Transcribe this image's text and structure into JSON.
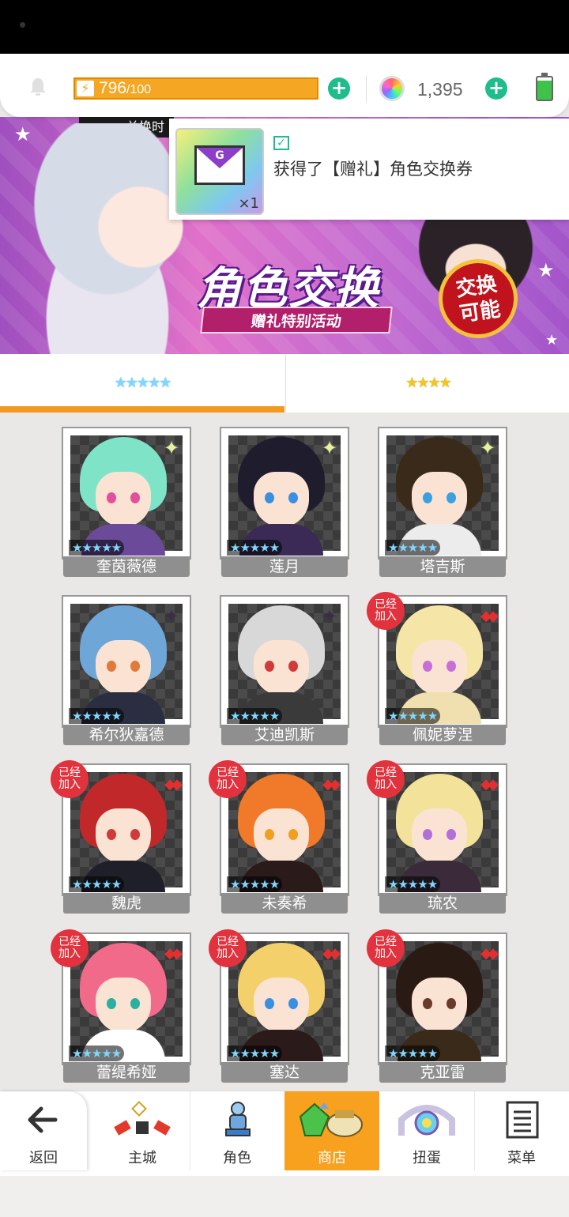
{
  "top_bar": {
    "energy_value": "796",
    "energy_max": "/100",
    "energy_fill": 1.0,
    "gem_count": "1,395"
  },
  "banner": {
    "title": "角色交换",
    "subtitle": "赠礼特别活动",
    "badge": "交换可能",
    "badge_line1": "交换",
    "badge_line2": "可能",
    "strip_label": "兑换时"
  },
  "toast": {
    "message": "获得了【赠礼】角色交换券",
    "qty": "×1",
    "item_letter": "G"
  },
  "tabs": [
    {
      "label": "★★★★★",
      "active": true
    },
    {
      "label": "★★★★",
      "active": false
    }
  ],
  "characters": [
    {
      "name": "奎茵薇德",
      "stars": "★★★★★",
      "added": false,
      "rank_icon": "sparkle-icon",
      "hair": "#7fe3c8",
      "eyes": "#e44f9c",
      "outfit": "#6b4a9a"
    },
    {
      "name": "莲月",
      "stars": "★★★★★",
      "added": false,
      "rank_icon": "sparkle-icon",
      "hair": "#1f1c2e",
      "eyes": "#3a8fe0",
      "outfit": "#3a2a55"
    },
    {
      "name": "塔吉斯",
      "stars": "★★★★★",
      "added": false,
      "rank_icon": "sparkle-icon",
      "hair": "#3a2a1a",
      "eyes": "#3aa0e0",
      "outfit": "#ececec"
    },
    {
      "name": "希尔狄嘉德",
      "stars": "★★★★★",
      "added": false,
      "rank_icon": "dark-sparkle-icon",
      "hair": "#6fa6d8",
      "eyes": "#e07a3a",
      "outfit": "#2a2e40"
    },
    {
      "name": "艾迪凯斯",
      "stars": "★★★★★",
      "added": false,
      "rank_icon": "dark-sparkle-icon",
      "hair": "#d8d8d8",
      "eyes": "#d03a3a",
      "outfit": "#3a3a3a"
    },
    {
      "name": "佩妮萝涅",
      "stars": "★★★★★",
      "added": true,
      "rank_icon": "diamond-icon",
      "hair": "#f5e6a8",
      "eyes": "#c86fd6",
      "outfit": "#f0e0b0"
    },
    {
      "name": "魏虎",
      "stars": "★★★★★",
      "added": true,
      "rank_icon": "diamond-icon",
      "hair": "#c0282a",
      "eyes": "#d03a3a",
      "outfit": "#1f1f2a"
    },
    {
      "name": "未奏希",
      "stars": "★★★★★",
      "added": true,
      "rank_icon": "diamond-icon",
      "hair": "#f07a2a",
      "eyes": "#f0a020",
      "outfit": "#2a1a1a"
    },
    {
      "name": "琉农",
      "stars": "★★★★★",
      "added": true,
      "rank_icon": "diamond-icon",
      "hair": "#f2e29a",
      "eyes": "#b070d8",
      "outfit": "#3a2a3a"
    },
    {
      "name": "蕾缇希娅",
      "stars": "★★★★★",
      "added": true,
      "rank_icon": "diamond-icon",
      "hair": "#f26a8a",
      "eyes": "#2ab0a0",
      "outfit": "#ffffff"
    },
    {
      "name": "塞达",
      "stars": "★★★★★",
      "added": true,
      "rank_icon": "diamond-icon",
      "hair": "#f3d06a",
      "eyes": "#3a8fe0",
      "outfit": "#2a1a1a"
    },
    {
      "name": "克亚雷",
      "stars": "★★★★★",
      "added": true,
      "rank_icon": "diamond-icon",
      "hair": "#2a1a14",
      "eyes": "#6a3a2a",
      "outfit": "#3a2a1a"
    }
  ],
  "added_label_line1": "已经",
  "added_label_line2": "加入",
  "nav": [
    {
      "label": "返回",
      "icon": "back-arrow-icon"
    },
    {
      "label": "主城",
      "icon": "castle-icon"
    },
    {
      "label": "角色",
      "icon": "character-icon"
    },
    {
      "label": "商店",
      "icon": "shop-icon",
      "active": true
    },
    {
      "label": "扭蛋",
      "icon": "gacha-icon"
    },
    {
      "label": "菜单",
      "icon": "menu-icon"
    }
  ],
  "colors": {
    "accent": "#f39a1e",
    "plus": "#1fbd8c",
    "added_badge": "#e2323e"
  }
}
